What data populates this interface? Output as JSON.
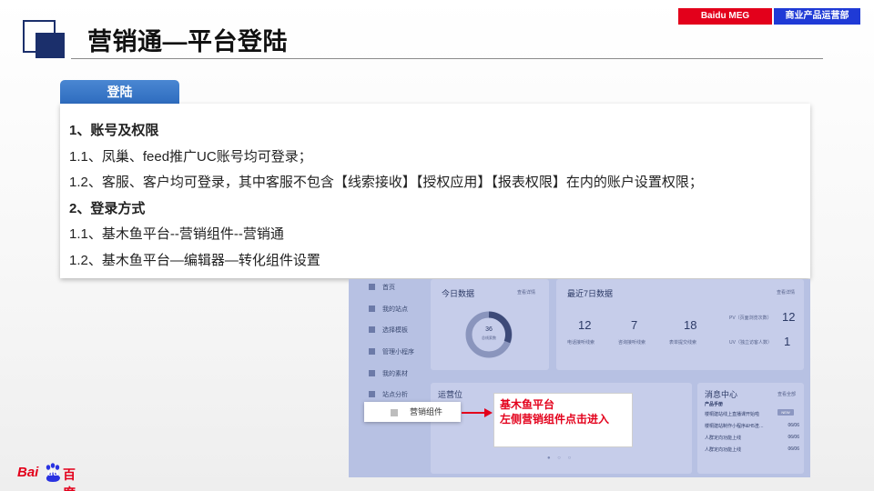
{
  "header": {
    "title": "营销通—平台登陆",
    "brand_left": "Baidu MEG",
    "brand_right": "商业产品运营部"
  },
  "section_tab": "登陆",
  "content_lines": [
    {
      "text": "1、账号及权限",
      "bold": true
    },
    {
      "text": "1.1、凤巢、feed推广UC账号均可登录；",
      "bold": false
    },
    {
      "text": "1.2、客服、客户均可登录，其中客服不包含【线索接收】【授权应用】【报表权限】在内的账户设置权限；",
      "bold": false
    },
    {
      "text": "2、登录方式",
      "bold": true
    },
    {
      "text": "1.1、基木鱼平台--营销组件--营销通",
      "bold": false
    },
    {
      "text": "1.2、基木鱼平台—编辑器—转化组件设置",
      "bold": false
    }
  ],
  "screenshot": {
    "sidebar": [
      "首页",
      "我的站点",
      "选择模板",
      "管理小程序",
      "我的素材",
      "站点分析"
    ],
    "today": {
      "title": "今日数据",
      "link": "查看详情",
      "center_value": "36",
      "center_label": "总线索数"
    },
    "week": {
      "title": "最近7日数据",
      "link": "查看详情",
      "stats": [
        {
          "value": "12",
          "label": "电话接听线索"
        },
        {
          "value": "7",
          "label": "咨询接听线索"
        },
        {
          "value": "18",
          "label": "表单提交线索"
        }
      ],
      "side_stats": [
        {
          "label": "PV（页面浏览次数）",
          "value": "12"
        },
        {
          "label": "UV（独立访客人数）",
          "value": "1"
        }
      ]
    },
    "operation": {
      "title": "运营位"
    },
    "messages": {
      "title": "消息中心",
      "link": "查看全部",
      "section": "产品手册",
      "badge": "NEW",
      "rows": [
        {
          "text": "楼桐建站线上直播课开始啦",
          "date": ""
        },
        {
          "text": "楼桐建站制作小程序&H5渣…",
          "date": "06/06"
        },
        {
          "text": "人群定向功能上线",
          "date": "06/06"
        },
        {
          "text": "人群定向功能上线",
          "date": "06/06"
        }
      ]
    }
  },
  "component_chip": "营销组件",
  "callout": {
    "line1": "基木鱼平台",
    "line2": "左侧营销组件点击进入"
  },
  "logo": {
    "bai": "Bai",
    "du": "du",
    "cn": "百度"
  },
  "colors": {
    "brand_red": "#e3001b",
    "brand_blue": "#1f3ad6",
    "title_navy": "#1b2f6b",
    "tab_blue": "#2e6cbf"
  }
}
